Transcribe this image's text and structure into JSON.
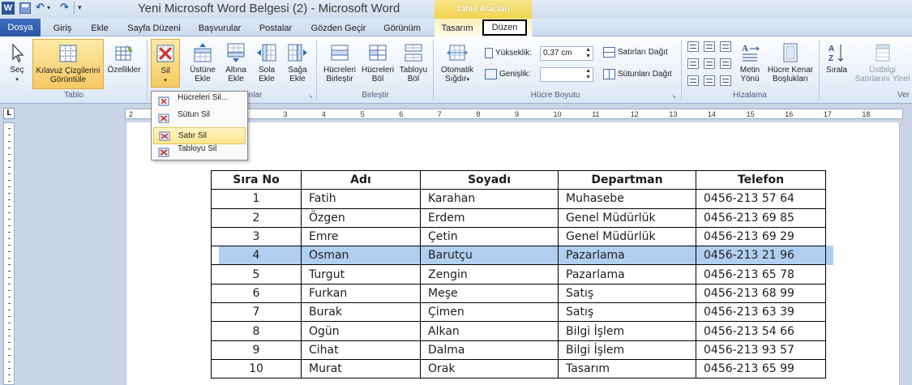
{
  "titlebar": {
    "app_icon": "W",
    "title": "Yeni Microsoft Word Belgesi (2)  -  Microsoft Word",
    "context_group": "Tablo Araçları",
    "qat_icons": [
      "save-icon",
      "undo-icon",
      "redo-icon",
      "customize-icon"
    ]
  },
  "tabs": {
    "file": "Dosya",
    "home": "Giriş",
    "insert": "Ekle",
    "page_layout": "Sayfa Düzeni",
    "references": "Başvurular",
    "mailings": "Postalar",
    "review": "Gözden Geçir",
    "view": "Görünüm",
    "design": "Tasarım",
    "layout": "Düzen"
  },
  "ribbon": {
    "table_group": {
      "label": "Tablo",
      "select": "Seç",
      "gridlines_line1": "Kılavuz Çizgilerini",
      "gridlines_line2": "Görüntüle",
      "properties": "Özellikler"
    },
    "rows_group": {
      "label": "nlar",
      "delete": "Sil",
      "insert_above_1": "Üstüne",
      "insert_above_2": "Ekle",
      "insert_below_1": "Altına",
      "insert_below_2": "Ekle",
      "insert_left_1": "Sola",
      "insert_left_2": "Ekle",
      "insert_right_1": "Sağa",
      "insert_right_2": "Ekle"
    },
    "merge_group": {
      "label": "Birleştir",
      "merge_cells_1": "Hücreleri",
      "merge_cells_2": "Birleştir",
      "split_cells_1": "Hücreleri",
      "split_cells_2": "Böl",
      "split_table_1": "Tabloyu",
      "split_table_2": "Böl"
    },
    "cell_size_group": {
      "label": "Hücre Boyutu",
      "autofit_1": "Otomatik",
      "autofit_2": "Sığdır",
      "height_label": "Yükseklik:",
      "height_value": "0,37 cm",
      "width_label": "Genişlik:",
      "width_value": "",
      "distribute_rows": "Satırları Dağıt",
      "distribute_columns": "Sütunları Dağıt"
    },
    "alignment_group": {
      "label": "Hizalama",
      "text_direction_1": "Metin",
      "text_direction_2": "Yönü",
      "cell_margins_1": "Hücre Kenar",
      "cell_margins_2": "Boşlukları"
    },
    "data_group": {
      "label": "Ver",
      "sort": "Sırala",
      "repeat_header_1": "Üstbilgi",
      "repeat_header_2": "Satırlarını Yinel"
    }
  },
  "delete_menu": {
    "items": [
      {
        "label": "Hücreleri Sil...",
        "icon": "delete-cells-icon"
      },
      {
        "label": "Sütun Sil",
        "icon": "delete-columns-icon"
      },
      {
        "label": "Satır Sil",
        "icon": "delete-rows-icon"
      },
      {
        "label": "Tabloyu Sil",
        "icon": "delete-table-icon"
      }
    ],
    "highlighted": "Satır Sil"
  },
  "ruler": {
    "numbers": [
      "2",
      "1",
      "1",
      "2",
      "3",
      "4",
      "5",
      "6",
      "7",
      "8",
      "9",
      "10",
      "11",
      "12",
      "13",
      "14",
      "15",
      "16",
      "17",
      "18"
    ],
    "corner": "L"
  },
  "table": {
    "headers": [
      "Sıra No",
      "Adı",
      "Soyadı",
      "Departman",
      "Telefon"
    ],
    "rows": [
      [
        "1",
        "Fatih",
        "Karahan",
        "Muhasebe",
        "0456-213 57 64"
      ],
      [
        "2",
        "Özgen",
        "Erdem",
        "Genel Müdürlük",
        "0456-213 69 85"
      ],
      [
        "3",
        "Emre",
        "Çetin",
        "Genel Müdürlük",
        "0456-213 69 29"
      ],
      [
        "4",
        "Osman",
        "Barutçu",
        "Pazarlama",
        "0456-213 21 96"
      ],
      [
        "5",
        "Turgut",
        "Zengin",
        "Pazarlama",
        "0456-213 65 78"
      ],
      [
        "6",
        "Furkan",
        "Meşe",
        "Satış",
        "0456-213 68 99"
      ],
      [
        "7",
        "Burak",
        "Çimen",
        "Satış",
        "0456-213 63 39"
      ],
      [
        "8",
        "Ogün",
        "Alkan",
        "Bilgi İşlem",
        "0456-213 54 66"
      ],
      [
        "9",
        "Cihat",
        "Dalma",
        "Bilgi İşlem",
        "0456-213 93 57"
      ],
      [
        "10",
        "Murat",
        "Orak",
        "Tasarım",
        "0456-213 65 99"
      ]
    ],
    "selected_row": "4"
  },
  "colors": {
    "file_tab": "#2a56a3",
    "context_tab": "#f1d44f",
    "selection": "#b1cff0",
    "menu_highlight": "#fde68f"
  }
}
